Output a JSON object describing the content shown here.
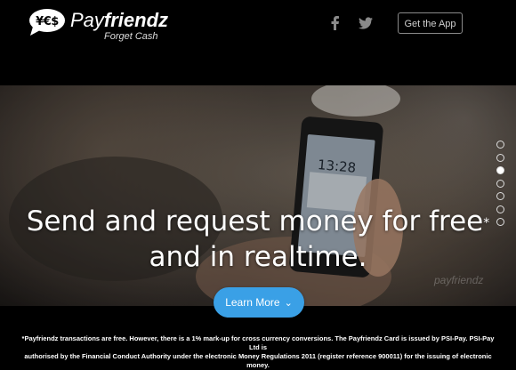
{
  "header": {
    "logo": {
      "bubble_text": "¥€$",
      "name_prefix": "Pay",
      "name_bold": "friendz",
      "tagline": "Forget Cash"
    },
    "social": {
      "facebook_icon": "facebook-icon",
      "twitter_icon": "twitter-icon"
    },
    "get_app_label": "Get the App"
  },
  "hero": {
    "headline_part1": "Send and request money for free",
    "headline_mark": "*",
    "headline_part2": " and in realtime.",
    "watermark": "payfriendz",
    "slider_dots": {
      "count": 7,
      "active_index": 2
    }
  },
  "cta": {
    "learn_more_label": "Learn More",
    "chevron_icon": "chevron-down-icon"
  },
  "footer": {
    "disclaimer_line1": "*Payfriendz transactions are free. However, there is a 1% mark-up for cross currency conversions. The Payfriendz Card is issued by PSI-Pay. PSI-Pay Ltd is",
    "disclaimer_line2": "authorised by the Financial Conduct Authority under the electronic Money Regulations 2011 (register reference 900011) for the issuing of electronic money."
  },
  "colors": {
    "accent": "#3aa0e6",
    "background": "#000000"
  }
}
